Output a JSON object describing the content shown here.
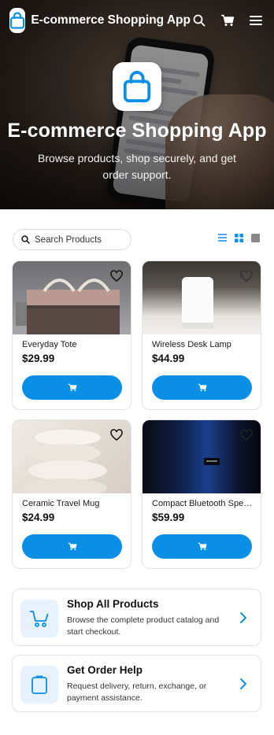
{
  "app": {
    "title": "E-commerce Shopping App"
  },
  "hero": {
    "title": "E-commerce Shopping App",
    "subtitle": "Browse products, shop securely, and get order support."
  },
  "search": {
    "placeholder": "Search Products"
  },
  "view_modes": [
    "list",
    "grid",
    "single"
  ],
  "products": [
    {
      "name": "Everyday Tote",
      "price": "$29.99",
      "image": "tote-bag-photo"
    },
    {
      "name": "Wireless Desk Lamp",
      "price": "$44.99",
      "image": "desk-lamp-photo"
    },
    {
      "name": "Ceramic Travel Mug",
      "price": "$24.99",
      "image": "ceramic-mugs-photo"
    },
    {
      "name": "Compact Bluetooth Speaker",
      "price": "$59.99",
      "image": "bluetooth-speaker-photo"
    }
  ],
  "actions": [
    {
      "title": "Shop All Products",
      "description": "Browse the complete product catalog and start checkout.",
      "icon": "cart-icon"
    },
    {
      "title": "Get Order Help",
      "description": "Request delivery, return, exchange, or payment assistance.",
      "icon": "clipboard-icon"
    }
  ],
  "colors": {
    "accent": "#0A8FE6",
    "icon_bg": "#E6F1FB"
  }
}
